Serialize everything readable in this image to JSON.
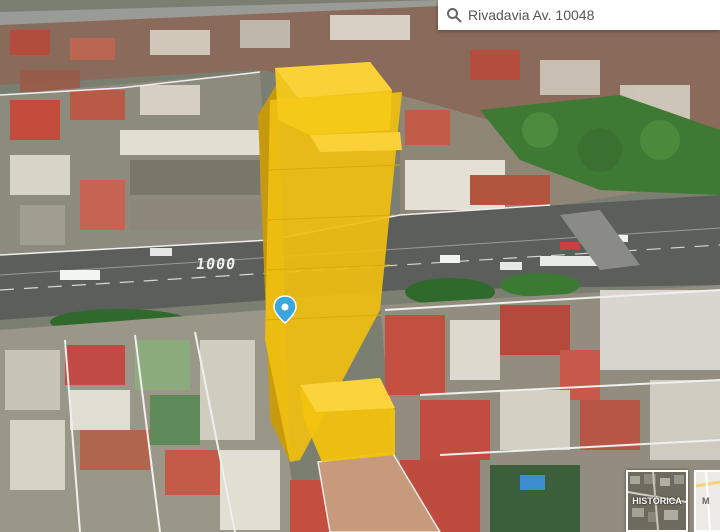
{
  "search": {
    "value": "Rivadavia Av. 10048",
    "icon": "search-icon"
  },
  "map": {
    "street_number": "1000"
  },
  "layers": {
    "historic_label": "HISTÓRICA",
    "map_label": "M"
  },
  "colors": {
    "building": "#f2c10c",
    "marker": "#3ba7dc"
  }
}
